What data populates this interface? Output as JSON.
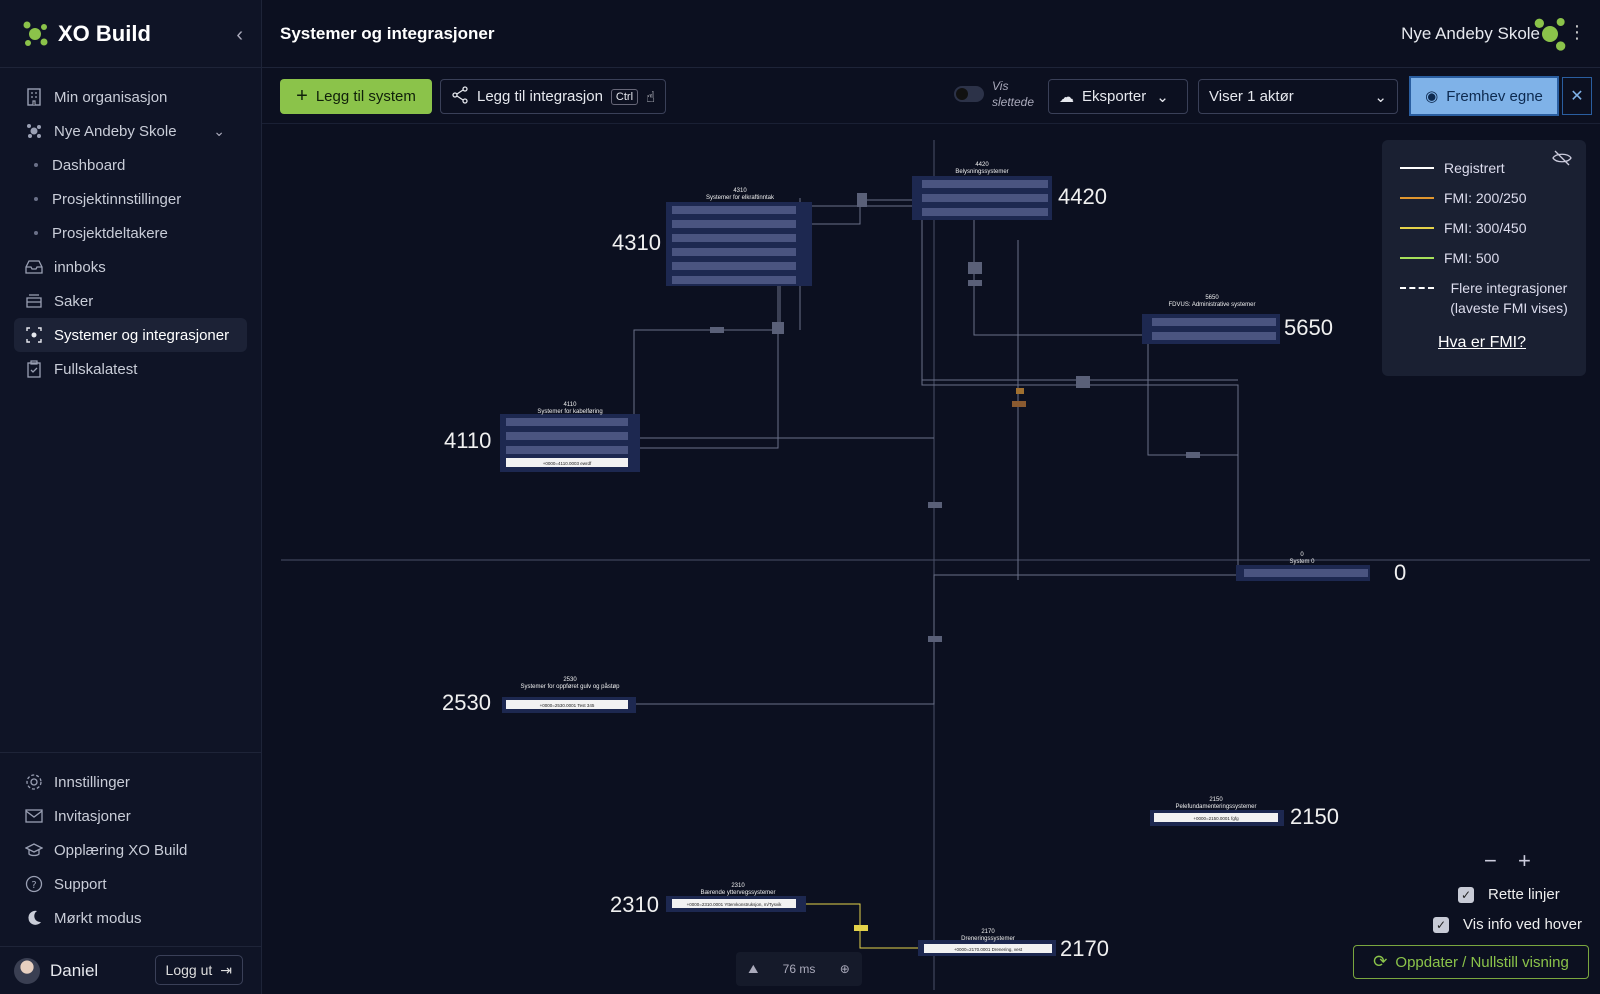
{
  "app": {
    "name": "XO Build"
  },
  "sidebar": {
    "items": [
      {
        "label": "Min organisasjon"
      },
      {
        "label": "Nye Andeby Skole"
      },
      {
        "label": "Dashboard"
      },
      {
        "label": "Prosjektinnstillinger"
      },
      {
        "label": "Prosjektdeltakere"
      },
      {
        "label": "innboks"
      },
      {
        "label": "Saker"
      },
      {
        "label": "Systemer og integrasjoner"
      },
      {
        "label": "Fullskalatest"
      }
    ],
    "bottom_items": [
      {
        "label": "Innstillinger"
      },
      {
        "label": "Invitasjoner"
      },
      {
        "label": "Opplæring XO Build"
      },
      {
        "label": "Support"
      },
      {
        "label": "Mørkt modus"
      }
    ],
    "user": {
      "name": "Daniel",
      "logout_label": "Logg ut"
    }
  },
  "header": {
    "title": "Systemer og integrasjoner",
    "org_name": "Nye Andeby Skole"
  },
  "toolbar": {
    "add_system": "Legg til system",
    "add_integration": "Legg til integrasjon",
    "shortcut": "Ctrl",
    "show_deleted": "Vis slettede",
    "export": "Eksporter",
    "actor_select": "Viser 1 aktør",
    "highlight_own": "Fremhev egne"
  },
  "legend": {
    "items": [
      {
        "label": "Registrert",
        "color": "#ffffff",
        "style": "solid"
      },
      {
        "label": "FMI: 200/250",
        "color": "#e0962e",
        "style": "solid"
      },
      {
        "label": "FMI: 300/450",
        "color": "#e4d24a",
        "style": "solid"
      },
      {
        "label": "FMI: 500",
        "color": "#a6e05a",
        "style": "solid"
      },
      {
        "label": "Flere integrasjoner (laveste FMI vises)",
        "color": "#ffffff",
        "style": "dashed"
      }
    ],
    "link": "Hva er FMI?"
  },
  "nodes": [
    {
      "number": "4420",
      "title": "Belysningssystemer"
    },
    {
      "number": "4310",
      "title": "Systemer for elkraftinntak"
    },
    {
      "number": "5650",
      "title": "FDVUS: Administrative systemer"
    },
    {
      "number": "4110",
      "title": "Systemer for kabelføring",
      "item": "+0000=4110.0003 ewrdf"
    },
    {
      "number": "0",
      "title": "System 0"
    },
    {
      "number": "2530",
      "title": "Systemer for oppføret gulv og påstøp",
      "item": "+0000=2530.0001 Test 345"
    },
    {
      "number": "2150",
      "title": "Pelefundamenteringssystemer",
      "item": "+0000=2150.0001 fgfg"
    },
    {
      "number": "2310",
      "title": "Bærende yttervegssystemer",
      "item": "+0000=2310.0001 Yttervkonstruksjon, m/Tysvik"
    },
    {
      "number": "2170",
      "title": "Dreneringssystemer",
      "item": "+0000=2170.0001 Drenering, vest"
    }
  ],
  "controls": {
    "straight_lines": "Rette linjer",
    "show_hover_info": "Vis info ved hover",
    "refresh": "Oppdater / Nullstill visning",
    "render_time": "76 ms"
  }
}
